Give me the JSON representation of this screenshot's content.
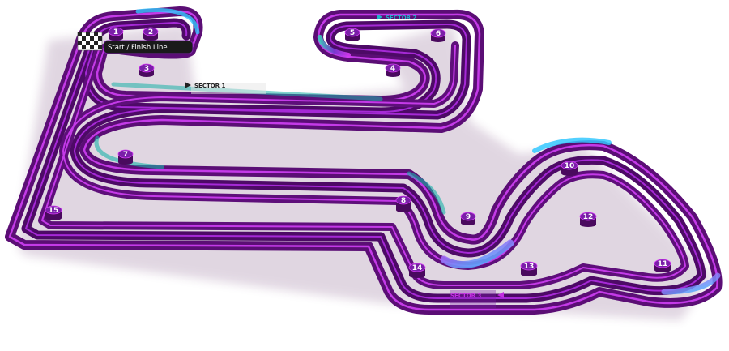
{
  "track": {
    "start_finish_label": "Start / Finish Line",
    "sectors": [
      "SECTOR 1",
      "SECTOR 2",
      "SECTOR 3"
    ],
    "turns": [
      "1",
      "2",
      "3",
      "4",
      "5",
      "6",
      "7",
      "8",
      "9",
      "10",
      "11",
      "12",
      "13",
      "14",
      "15"
    ]
  },
  "colors": {
    "wall_dark": "#4a0a5e",
    "wall_mid": "#6a1b80",
    "wall_light": "#a020e0",
    "accent_magenta": "#d63cf5",
    "accent_teal": "#19b3a8",
    "accent_cyan": "#34c8ff",
    "marker_fill": "#7a1fa8",
    "sector2_color": "#1fb5c9",
    "sector1_color": "#222222",
    "sector3_color": "#c22fe0"
  }
}
